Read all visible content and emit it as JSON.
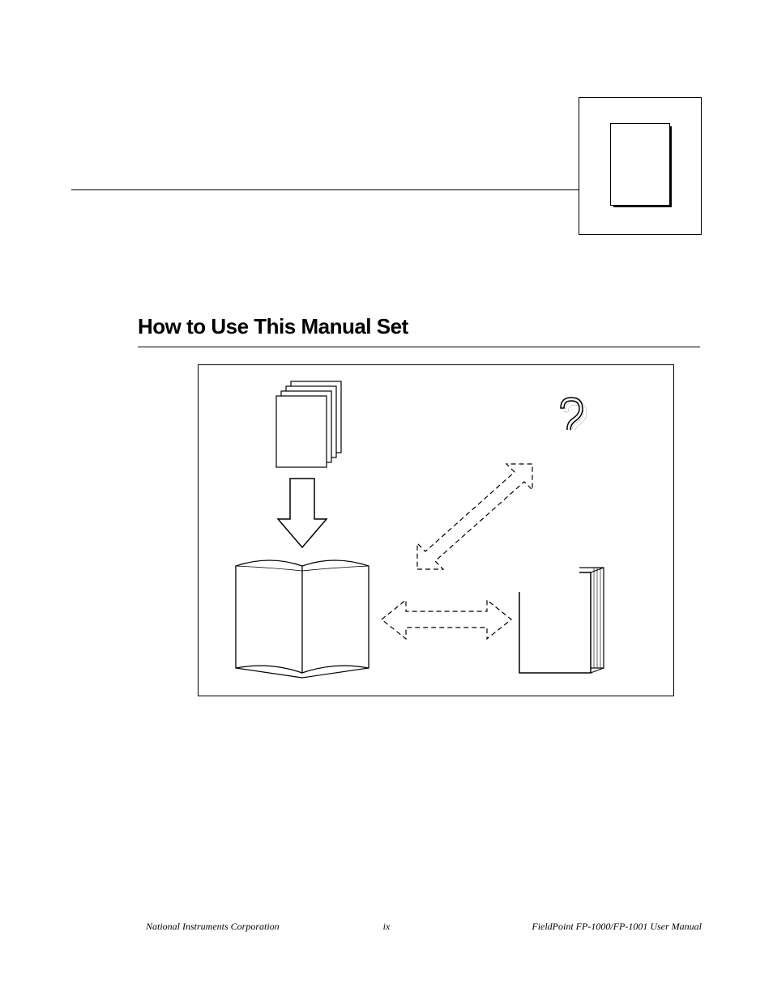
{
  "section_title": "How to Use This Manual Set",
  "footer": {
    "left": "National Instruments Corporation",
    "center": "ix",
    "right": "FieldPoint FP-1000/FP-1001 User Manual"
  },
  "icons": {
    "top_right": "document-icon",
    "stacked_docs": "stacked-documents-icon",
    "arrow_down": "arrow-down-icon",
    "open_book": "open-book-icon",
    "question": "question-mark-icon",
    "closed_book": "closed-book-icon",
    "arrow_dashed_diag": "dashed-double-arrow-icon",
    "arrow_dashed_horiz": "dashed-double-arrow-icon"
  }
}
